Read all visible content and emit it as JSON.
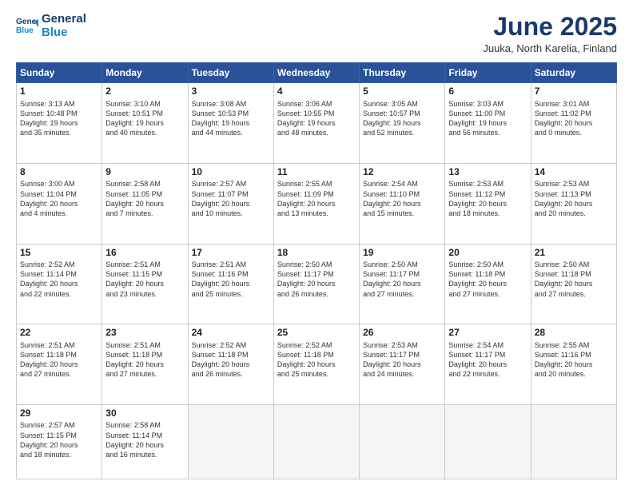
{
  "logo": {
    "line1": "General",
    "line2": "Blue"
  },
  "title": "June 2025",
  "subtitle": "Juuka, North Karelia, Finland",
  "days_of_week": [
    "Sunday",
    "Monday",
    "Tuesday",
    "Wednesday",
    "Thursday",
    "Friday",
    "Saturday"
  ],
  "weeks": [
    [
      {
        "num": "1",
        "info": "Sunrise: 3:13 AM\nSunset: 10:48 PM\nDaylight: 19 hours\nand 35 minutes."
      },
      {
        "num": "2",
        "info": "Sunrise: 3:10 AM\nSunset: 10:51 PM\nDaylight: 19 hours\nand 40 minutes."
      },
      {
        "num": "3",
        "info": "Sunrise: 3:08 AM\nSunset: 10:53 PM\nDaylight: 19 hours\nand 44 minutes."
      },
      {
        "num": "4",
        "info": "Sunrise: 3:06 AM\nSunset: 10:55 PM\nDaylight: 19 hours\nand 48 minutes."
      },
      {
        "num": "5",
        "info": "Sunrise: 3:05 AM\nSunset: 10:57 PM\nDaylight: 19 hours\nand 52 minutes."
      },
      {
        "num": "6",
        "info": "Sunrise: 3:03 AM\nSunset: 11:00 PM\nDaylight: 19 hours\nand 56 minutes."
      },
      {
        "num": "7",
        "info": "Sunrise: 3:01 AM\nSunset: 11:02 PM\nDaylight: 20 hours\nand 0 minutes."
      }
    ],
    [
      {
        "num": "8",
        "info": "Sunrise: 3:00 AM\nSunset: 11:04 PM\nDaylight: 20 hours\nand 4 minutes."
      },
      {
        "num": "9",
        "info": "Sunrise: 2:58 AM\nSunset: 11:05 PM\nDaylight: 20 hours\nand 7 minutes."
      },
      {
        "num": "10",
        "info": "Sunrise: 2:57 AM\nSunset: 11:07 PM\nDaylight: 20 hours\nand 10 minutes."
      },
      {
        "num": "11",
        "info": "Sunrise: 2:55 AM\nSunset: 11:09 PM\nDaylight: 20 hours\nand 13 minutes."
      },
      {
        "num": "12",
        "info": "Sunrise: 2:54 AM\nSunset: 11:10 PM\nDaylight: 20 hours\nand 15 minutes."
      },
      {
        "num": "13",
        "info": "Sunrise: 2:53 AM\nSunset: 11:12 PM\nDaylight: 20 hours\nand 18 minutes."
      },
      {
        "num": "14",
        "info": "Sunrise: 2:53 AM\nSunset: 11:13 PM\nDaylight: 20 hours\nand 20 minutes."
      }
    ],
    [
      {
        "num": "15",
        "info": "Sunrise: 2:52 AM\nSunset: 11:14 PM\nDaylight: 20 hours\nand 22 minutes."
      },
      {
        "num": "16",
        "info": "Sunrise: 2:51 AM\nSunset: 11:15 PM\nDaylight: 20 hours\nand 23 minutes."
      },
      {
        "num": "17",
        "info": "Sunrise: 2:51 AM\nSunset: 11:16 PM\nDaylight: 20 hours\nand 25 minutes."
      },
      {
        "num": "18",
        "info": "Sunrise: 2:50 AM\nSunset: 11:17 PM\nDaylight: 20 hours\nand 26 minutes."
      },
      {
        "num": "19",
        "info": "Sunrise: 2:50 AM\nSunset: 11:17 PM\nDaylight: 20 hours\nand 27 minutes."
      },
      {
        "num": "20",
        "info": "Sunrise: 2:50 AM\nSunset: 11:18 PM\nDaylight: 20 hours\nand 27 minutes."
      },
      {
        "num": "21",
        "info": "Sunrise: 2:50 AM\nSunset: 11:18 PM\nDaylight: 20 hours\nand 27 minutes."
      }
    ],
    [
      {
        "num": "22",
        "info": "Sunrise: 2:51 AM\nSunset: 11:18 PM\nDaylight: 20 hours\nand 27 minutes."
      },
      {
        "num": "23",
        "info": "Sunrise: 2:51 AM\nSunset: 11:18 PM\nDaylight: 20 hours\nand 27 minutes."
      },
      {
        "num": "24",
        "info": "Sunrise: 2:52 AM\nSunset: 11:18 PM\nDaylight: 20 hours\nand 26 minutes."
      },
      {
        "num": "25",
        "info": "Sunrise: 2:52 AM\nSunset: 11:18 PM\nDaylight: 20 hours\nand 25 minutes."
      },
      {
        "num": "26",
        "info": "Sunrise: 2:53 AM\nSunset: 11:17 PM\nDaylight: 20 hours\nand 24 minutes."
      },
      {
        "num": "27",
        "info": "Sunrise: 2:54 AM\nSunset: 11:17 PM\nDaylight: 20 hours\nand 22 minutes."
      },
      {
        "num": "28",
        "info": "Sunrise: 2:55 AM\nSunset: 11:16 PM\nDaylight: 20 hours\nand 20 minutes."
      }
    ],
    [
      {
        "num": "29",
        "info": "Sunrise: 2:57 AM\nSunset: 11:15 PM\nDaylight: 20 hours\nand 18 minutes."
      },
      {
        "num": "30",
        "info": "Sunrise: 2:58 AM\nSunset: 11:14 PM\nDaylight: 20 hours\nand 16 minutes."
      },
      null,
      null,
      null,
      null,
      null
    ]
  ]
}
